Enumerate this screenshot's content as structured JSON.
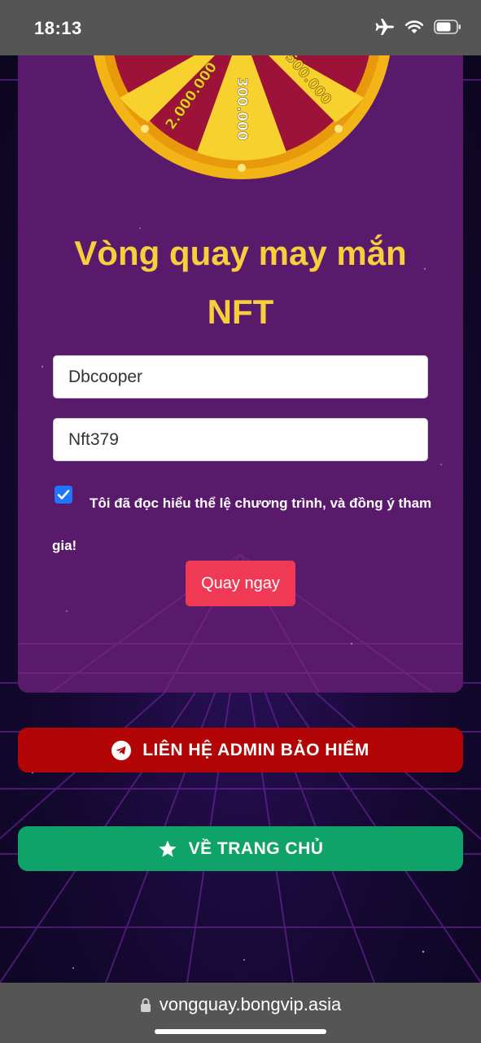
{
  "status_bar": {
    "time": "18:13",
    "icons": [
      "airplane-icon",
      "wifi-icon",
      "battery-icon"
    ]
  },
  "wheel": {
    "segment_labels": [
      "2.000.000",
      "300.000",
      "500.000"
    ]
  },
  "card": {
    "title_line1": "Vòng quay may mắn",
    "title_line2": "NFT",
    "username_value": "Dbcooper",
    "code_value": "Nft379",
    "agree_checked": true,
    "agree_text": "Tôi đã đọc hiểu thể lệ chương trình, và đồng ý tham gia!",
    "spin_button_label": "Quay ngay"
  },
  "buttons": {
    "contact_label": "LIÊN HỆ ADMIN BẢO HIỂM",
    "contact_icon": "telegram-icon",
    "home_label": "VỀ TRANG CHỦ",
    "home_icon": "star-icon"
  },
  "url_bar": {
    "url": "vongquay.bongvip.asia",
    "icon": "lock-icon"
  },
  "colors": {
    "card_bg": "#5a1a6b",
    "title": "#f7cf3c",
    "spin_button": "#f03a55",
    "contact_button": "#b30505",
    "home_button": "#0fa36a"
  }
}
